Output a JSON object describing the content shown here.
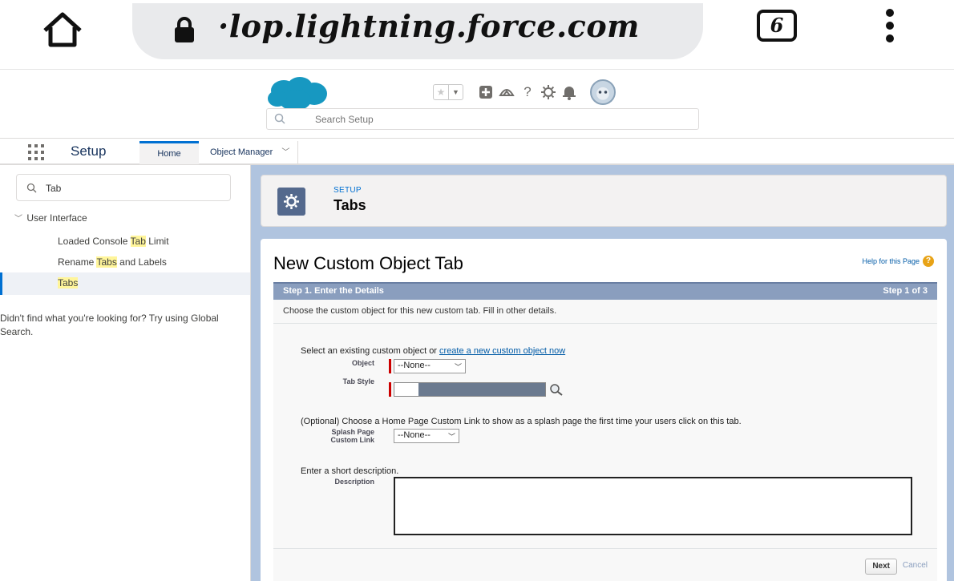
{
  "browser": {
    "url": "·lop.lightning.force.com",
    "tab_count": "6"
  },
  "header": {
    "search_placeholder": "Search Setup"
  },
  "setup_nav": {
    "app_name": "Setup",
    "home_tab": "Home",
    "object_manager_tab": "Object Manager"
  },
  "sidebar": {
    "quick_find_value": "Tab",
    "group_label": "User Interface",
    "items": [
      {
        "before": "Loaded Console ",
        "highlight": "Tab",
        "after": " Limit"
      },
      {
        "before": "Rename ",
        "highlight": "Tabs",
        "after": " and Labels"
      },
      {
        "before": "",
        "highlight": "Tabs",
        "after": ""
      }
    ],
    "not_found_text": "Didn't find what you're looking for? Try using Global Search."
  },
  "page_header": {
    "eyebrow": "SETUP",
    "title": "Tabs"
  },
  "content": {
    "title": "New Custom Object Tab",
    "help_link": "Help for this Page",
    "step_title": "Step 1. Enter the Details",
    "step_counter": "Step 1 of 3",
    "intro": "Choose the custom object for this new custom tab. Fill in other details.",
    "object_prompt": "Select an existing custom object or ",
    "object_prompt_link": "create a new custom object now",
    "object_label": "Object",
    "object_value": "--None--",
    "tab_style_label": "Tab Style",
    "splash_prompt": "(Optional) Choose a Home Page Custom Link to show as a splash page the first time your users click on this tab.",
    "splash_label_1": "Splash Page",
    "splash_label_2": "Custom Link",
    "splash_value": "--None--",
    "description_prompt": "Enter a short description.",
    "description_label": "Description",
    "next_button": "Next",
    "cancel_link": "Cancel"
  },
  "colors": {
    "brand_blue": "#0070d2",
    "step_bar": "#8a9ebe",
    "page_bg": "#b0c4df",
    "highlight": "#fff59a",
    "salesforce_cloud": "#1798c1"
  },
  "icons": [
    "home-icon",
    "lock-icon",
    "tab-count-icon",
    "kebab-menu-icon",
    "salesforce-logo",
    "favorites-star-icon",
    "add-icon",
    "trailhead-icon",
    "help-icon",
    "gear-icon",
    "bell-icon",
    "avatar",
    "search-icon",
    "waffle-icon",
    "setup-gear-icon",
    "lookup-icon"
  ]
}
